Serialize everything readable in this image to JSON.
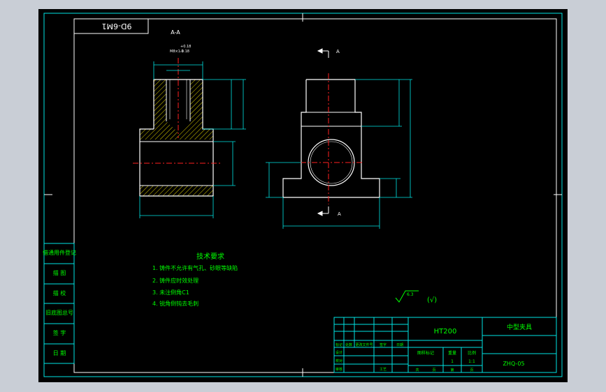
{
  "drawing_code_rotated": "9D-6M1",
  "view_label": "A-A",
  "section_arrow_top": "A",
  "section_arrow_bottom": "A",
  "tolerance_main": "M8×1.5",
  "tolerance_upper": "+0.18",
  "tolerance_lower": "-0.18",
  "tech_req": {
    "title": "技术要求",
    "items": [
      "1. 铸件不允许有气孔、砂眼等缺陷",
      "2. 铸件应时效处理",
      "3. 未注倒角C1",
      "4. 锐角倒钝去毛刺"
    ]
  },
  "roughness": {
    "value": "6.3",
    "rest": "(√)"
  },
  "left_table": [
    "借通用件登记",
    "描 图",
    "描 校",
    "旧底图总号",
    "签 字",
    "日 期"
  ],
  "title_block": {
    "material": "HT200",
    "part_name": "中型夹具",
    "drawing_no": "ZHQ-05",
    "scale": "1:1",
    "qty": "1",
    "headers": [
      "图样标记",
      "重量",
      "比例"
    ],
    "labels": [
      "标记",
      "处数",
      "更改文件号",
      "签字",
      "日期",
      "设计",
      "校对",
      "审核",
      "工艺",
      "共",
      "页",
      "第",
      "页"
    ]
  },
  "colors": {
    "frame": "#00e5e5",
    "part": "#ffffff",
    "green": "#00ff00",
    "center": "#ff2020",
    "hatch": "#e0d000"
  }
}
